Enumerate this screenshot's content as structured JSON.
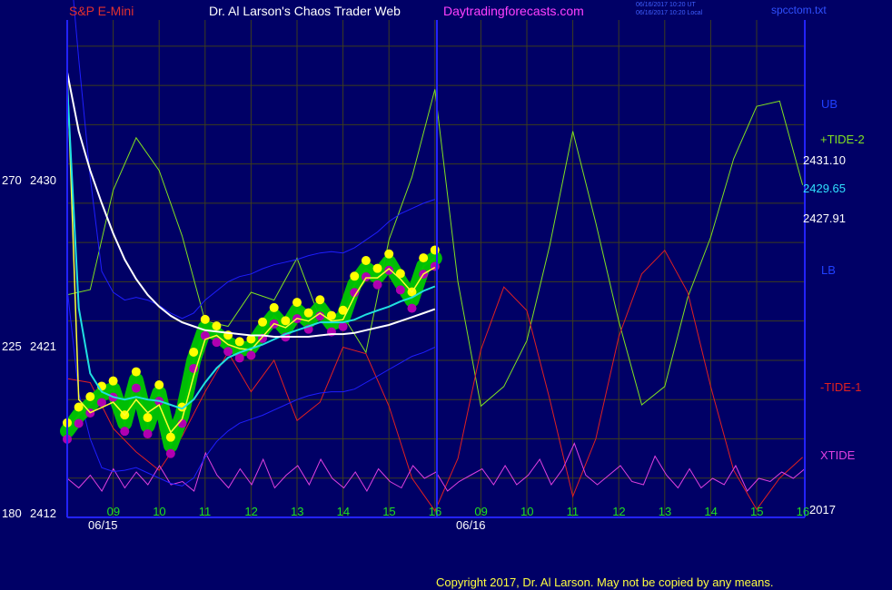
{
  "header": {
    "symbol": "S&P E-Mini",
    "brand": "Dr. Al Larson's Chaos Trader Web",
    "site": "Daytradingforecasts.com",
    "timestamp_utc": "06/16/2017 10:20 UT",
    "timestamp_local": "06/16/2017 10:20 Local",
    "file": "spcctom.txt"
  },
  "footer": {
    "copyright": "Copyright 2017, Dr. Al Larson. May not be copied by any means.",
    "year": "2017"
  },
  "colors": {
    "background": "#000066",
    "grid": "#3c3c1e",
    "frame": "#2323ff",
    "price": "#00c800",
    "xtide": "#e040e0",
    "tide_plus": "#80e020",
    "tide_minus": "#e02020",
    "bands": "#1e1eff",
    "cyan_avg": "#20e0e0",
    "white_avg": "#ffffff",
    "yellow_line": "#ffff30",
    "yellow_dots": "#ffff00",
    "magenta_dots": "#b000b0"
  },
  "chart_data": {
    "type": "line",
    "title": "S&P E-Mini",
    "xlabel": "",
    "ylabel": "",
    "grid": true,
    "x_axis": {
      "hour_ticks_day1": [
        "09",
        "10",
        "11",
        "12",
        "13",
        "14",
        "15",
        "16"
      ],
      "hour_ticks_day2": [
        "09",
        "10",
        "11",
        "12",
        "13",
        "14",
        "15",
        "16"
      ],
      "date_labels": [
        "06/15",
        "06/16"
      ]
    },
    "y_axis": {
      "ticks": [
        {
          "left": "180",
          "price": 2412
        },
        {
          "left": "225",
          "price": 2421
        },
        {
          "left": "270",
          "price": 2430
        }
      ],
      "ylim": [
        2412,
        2450
      ]
    },
    "price_labels": [
      "2431.10",
      "2429.65",
      "2427.91"
    ],
    "legend": [
      "UB",
      "+TIDE-2",
      "LB",
      "-TIDE-1",
      "XTIDE"
    ],
    "x_hours": [
      8.0,
      8.25,
      8.5,
      8.75,
      9.0,
      9.25,
      9.5,
      9.75,
      10.0,
      10.25,
      10.5,
      10.75,
      11.0,
      11.25,
      11.5,
      11.75,
      12.0,
      12.25,
      12.5,
      12.75,
      13.0,
      13.25,
      13.5,
      13.75,
      14.0,
      14.25,
      14.5,
      14.75,
      15.0,
      15.25,
      15.5,
      15.75,
      16.0
    ],
    "series": [
      {
        "name": "price",
        "values": [
          2418.6,
          2419.8,
          2420.6,
          2421.4,
          2421.8,
          2419.2,
          2422.5,
          2419.0,
          2421.5,
          2417.5,
          2419.8,
          2424.0,
          2426.5,
          2426.0,
          2425.3,
          2424.8,
          2425.0,
          2426.3,
          2427.4,
          2426.4,
          2427.8,
          2427.0,
          2428.0,
          2426.8,
          2427.2,
          2429.8,
          2431.0,
          2430.4,
          2431.5,
          2430.0,
          2428.6,
          2431.2,
          2431.8
        ]
      },
      {
        "name": "cyan_average",
        "values": [
          2445.0,
          2428.0,
          2423.0,
          2421.6,
          2421.2,
          2421.0,
          2421.2,
          2421.0,
          2420.9,
          2420.6,
          2420.3,
          2421.0,
          2422.3,
          2423.4,
          2424.2,
          2424.6,
          2424.9,
          2425.2,
          2425.6,
          2426.0,
          2426.3,
          2426.6,
          2426.9,
          2426.9,
          2426.9,
          2427.1,
          2427.5,
          2427.8,
          2428.1,
          2428.5,
          2428.8,
          2429.3,
          2429.65
        ]
      },
      {
        "name": "white_average",
        "values": [
          2446.0,
          2441.5,
          2438.5,
          2436.0,
          2433.7,
          2431.7,
          2430.2,
          2429.0,
          2428.1,
          2427.4,
          2426.9,
          2426.6,
          2426.3,
          2426.2,
          2426.1,
          2426.0,
          2425.9,
          2425.9,
          2425.8,
          2425.8,
          2425.8,
          2425.8,
          2425.9,
          2426.0,
          2426.0,
          2426.1,
          2426.3,
          2426.5,
          2426.7,
          2427.0,
          2427.3,
          2427.6,
          2427.91
        ]
      },
      {
        "name": "yellow_fast_average",
        "values": [
          2446.0,
          2421.0,
          2420.0,
          2420.4,
          2420.8,
          2419.8,
          2421.0,
          2420.0,
          2420.6,
          2418.5,
          2419.5,
          2422.8,
          2425.6,
          2425.9,
          2425.2,
          2424.9,
          2424.8,
          2425.8,
          2426.8,
          2426.5,
          2427.2,
          2427.0,
          2427.6,
          2427.0,
          2427.1,
          2428.9,
          2430.3,
          2430.3,
          2431.0,
          2430.2,
          2429.2,
          2430.6,
          2431.1
        ]
      },
      {
        "name": "upper_band",
        "values": [
          2457.0,
          2447.0,
          2438.0,
          2430.8,
          2429.2,
          2428.6,
          2428.8,
          2428.6,
          2428.2,
          2427.6,
          2427.2,
          2427.6,
          2428.6,
          2429.3,
          2430.0,
          2430.4,
          2430.6,
          2431.0,
          2431.3,
          2431.5,
          2431.7,
          2432.0,
          2432.2,
          2432.3,
          2432.2,
          2432.6,
          2433.2,
          2433.8,
          2434.6,
          2435.2,
          2435.6,
          2436.0,
          2436.3
        ]
      },
      {
        "name": "lower_band",
        "values": [
          2429.5,
          2421.5,
          2418.0,
          2415.8,
          2415.5,
          2415.6,
          2415.8,
          2415.4,
          2415.0,
          2414.6,
          2414.4,
          2415.0,
          2416.6,
          2417.8,
          2418.6,
          2419.2,
          2419.5,
          2419.8,
          2420.2,
          2420.6,
          2421.0,
          2421.3,
          2421.5,
          2421.6,
          2421.6,
          2421.8,
          2422.3,
          2422.8,
          2423.3,
          2423.8,
          2424.3,
          2424.6,
          2425.0
        ]
      }
    ],
    "tide_x_hours": [
      8.0,
      8.5,
      9.0,
      9.5,
      10.0,
      10.5,
      11.0,
      11.5,
      12.0,
      12.5,
      13.0,
      13.5,
      14.0,
      14.5,
      15.0,
      15.5,
      16.0,
      16.5,
      17.0,
      17.5,
      18.0,
      18.5,
      19.0,
      19.5,
      20.0,
      20.5,
      21.0,
      21.5,
      22.0,
      22.5,
      23.0,
      23.5,
      24.0
    ],
    "tide_series": [
      {
        "name": "+TIDE-2",
        "values": [
          2429.0,
          2429.4,
          2437.0,
          2441.0,
          2438.5,
          2433.5,
          2427.0,
          2426.6,
          2429.2,
          2428.6,
          2431.8,
          2427.2,
          2427.4,
          2424.6,
          2433.2,
          2438.0,
          2444.7,
          2430.0,
          2420.5,
          2422.0,
          2425.5,
          2432.8,
          2441.5,
          2434.5,
          2427.0,
          2420.6,
          2422.0,
          2428.8,
          2433.4,
          2439.4,
          2443.4,
          2443.8,
          2437.4
        ]
      },
      {
        "name": "-TIDE-1",
        "values": [
          2422.6,
          2422.3,
          2418.8,
          2417.0,
          2415.6,
          2418.2,
          2421.6,
          2424.6,
          2421.6,
          2424.0,
          2419.4,
          2420.8,
          2425.0,
          2424.5,
          2420.5,
          2415.0,
          2412.5,
          2416.5,
          2424.8,
          2429.6,
          2427.8,
          2421.0,
          2413.6,
          2418.0,
          2425.8,
          2430.6,
          2432.4,
          2429.2,
          2422.0,
          2415.6,
          2412.6,
          2415.0,
          2416.6
        ]
      }
    ],
    "xtide_values": [
      0.4,
      0.25,
      0.45,
      0.2,
      0.55,
      0.25,
      0.5,
      0.3,
      0.6,
      0.3,
      0.35,
      0.2,
      0.8,
      0.45,
      0.25,
      0.55,
      0.3,
      0.7,
      0.25,
      0.45,
      0.6,
      0.3,
      0.7,
      0.4,
      0.25,
      0.5,
      0.2,
      0.55,
      0.35,
      0.25,
      0.6,
      0.4,
      0.5,
      0.2,
      0.35,
      0.45,
      0.55,
      0.3,
      0.6,
      0.3,
      0.45,
      0.7,
      0.3,
      0.55,
      0.95,
      0.45,
      0.3,
      0.45,
      0.6,
      0.35,
      0.3,
      0.75,
      0.45,
      0.25,
      0.55,
      0.25,
      0.4,
      0.3,
      0.6,
      0.2,
      0.4,
      0.35,
      0.5,
      0.4,
      0.55
    ]
  }
}
